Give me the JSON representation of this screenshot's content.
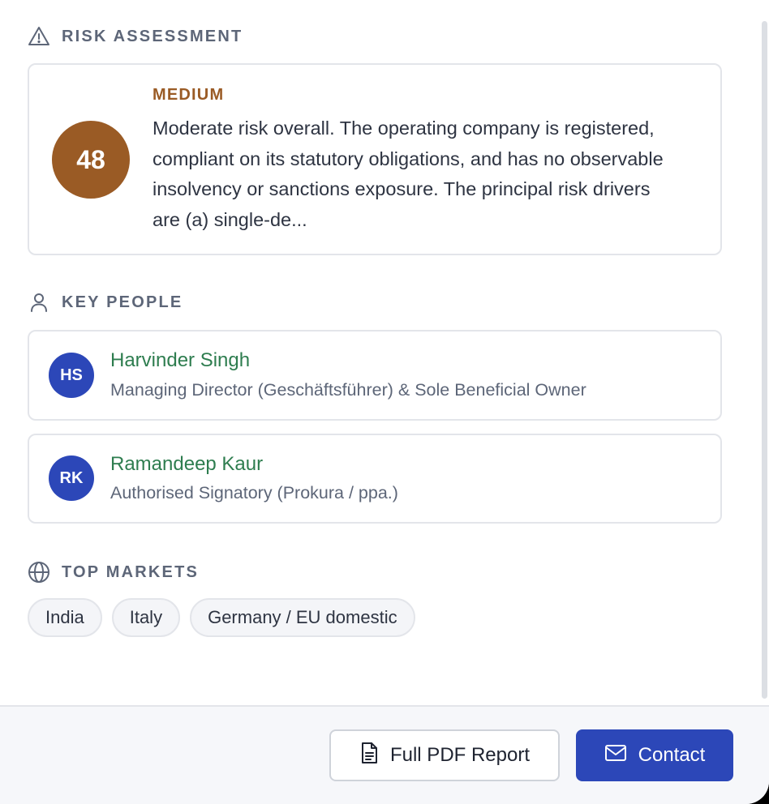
{
  "risk": {
    "header": "RISK ASSESSMENT",
    "score": "48",
    "level": "MEDIUM",
    "summary": "Moderate risk overall. The operating company is registered, compliant on its statutory obligations, and has no observable insolvency or sanctions exposure. The principal risk drivers are (a) single-de..."
  },
  "people": {
    "header": "KEY PEOPLE",
    "items": [
      {
        "initials": "HS",
        "name": "Harvinder Singh",
        "role": "Managing Director (Geschäftsführer) & Sole Beneficial Owner"
      },
      {
        "initials": "RK",
        "name": "Ramandeep Kaur",
        "role": "Authorised Signatory (Prokura / ppa.)"
      }
    ]
  },
  "markets": {
    "header": "TOP MARKETS",
    "items": [
      "India",
      "Italy",
      "Germany / EU domestic"
    ]
  },
  "footer": {
    "pdf_label": "Full PDF Report",
    "contact_label": "Contact"
  },
  "icons": {
    "risk": "warning-triangle-icon",
    "people": "person-icon",
    "markets": "globe-icon",
    "pdf": "document-icon",
    "contact": "mail-icon"
  },
  "colors": {
    "risk_medium": "#9a5b25",
    "avatar": "#2c47b8",
    "name": "#2e7d4f",
    "primary_button": "#2c47b8"
  }
}
